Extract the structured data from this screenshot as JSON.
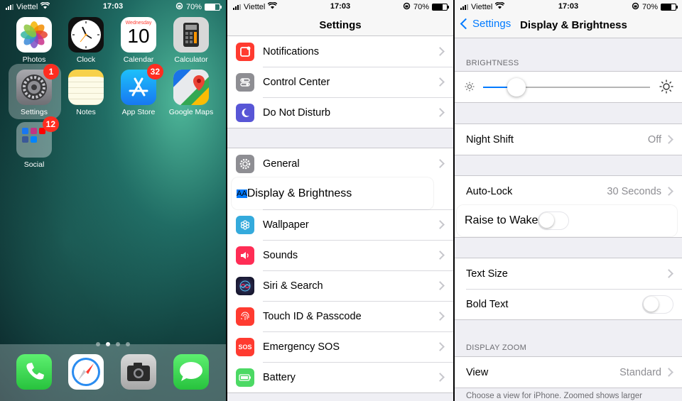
{
  "home": {
    "status": {
      "carrier": "Viettel",
      "time": "17:03",
      "battery": "70%",
      "battery_level": 0.7
    },
    "apps": [
      {
        "label": "Photos"
      },
      {
        "label": "Clock"
      },
      {
        "label": "Calendar",
        "weekday": "Wednesday",
        "day": "10"
      },
      {
        "label": "Calculator"
      },
      {
        "label": "Settings",
        "badge": "1"
      },
      {
        "label": "Notes"
      },
      {
        "label": "App Store",
        "badge": "32"
      },
      {
        "label": "Google Maps"
      },
      {
        "label": "Social",
        "badge": "12"
      }
    ],
    "dock": [
      "Phone",
      "Safari",
      "Camera",
      "Messages"
    ],
    "page_count": 4,
    "current_page": 2
  },
  "settings": {
    "status": {
      "carrier": "Viettel",
      "time": "17:03",
      "battery": "70%",
      "battery_level": 0.7
    },
    "title": "Settings",
    "items": [
      {
        "label": "Notifications",
        "icon": "notifications-icon",
        "color": "#ff3b30"
      },
      {
        "label": "Control Center",
        "icon": "control-center-icon",
        "color": "#8e8e93"
      },
      {
        "label": "Do Not Disturb",
        "icon": "moon-icon",
        "color": "#5856d6"
      },
      {
        "label": "General",
        "icon": "gear-icon",
        "color": "#8e8e93"
      },
      {
        "label": "Display & Brightness",
        "icon": "display-aa-icon",
        "color": "#007aff",
        "icon_text": "AA"
      },
      {
        "label": "Wallpaper",
        "icon": "wallpaper-icon",
        "color": "#34aadc"
      },
      {
        "label": "Sounds",
        "icon": "speaker-icon",
        "color": "#ff2d55"
      },
      {
        "label": "Siri & Search",
        "icon": "siri-icon",
        "color": "#1c1c3a"
      },
      {
        "label": "Touch ID & Passcode",
        "icon": "fingerprint-icon",
        "color": "#ff3b30"
      },
      {
        "label": "Emergency SOS",
        "icon": "sos-icon",
        "color": "#ff3b30",
        "icon_text": "SOS"
      },
      {
        "label": "Battery",
        "icon": "battery-icon",
        "color": "#4cd964"
      }
    ]
  },
  "display": {
    "status": {
      "carrier": "Viettel",
      "time": "17:03",
      "battery": "70%",
      "battery_level": 0.7
    },
    "back_label": "Settings",
    "title": "Display & Brightness",
    "brightness_header": "BRIGHTNESS",
    "brightness_level": 0.2,
    "night_shift": {
      "label": "Night Shift",
      "value": "Off"
    },
    "auto_lock": {
      "label": "Auto-Lock",
      "value": "30 Seconds"
    },
    "raise_to_wake": {
      "label": "Raise to Wake",
      "on": false
    },
    "text_size": {
      "label": "Text Size"
    },
    "bold_text": {
      "label": "Bold Text",
      "on": false
    },
    "zoom_header": "DISPLAY ZOOM",
    "view": {
      "label": "View",
      "value": "Standard"
    },
    "footer": "Choose a view for iPhone. Zoomed shows larger"
  }
}
